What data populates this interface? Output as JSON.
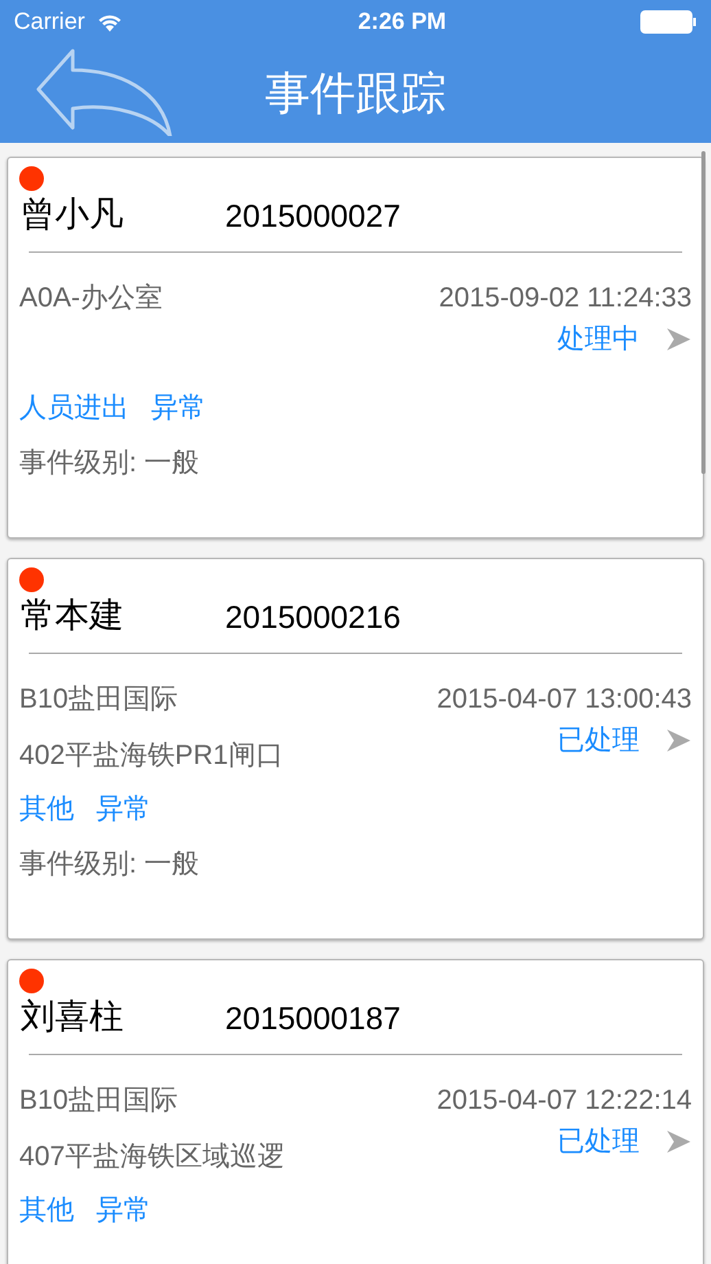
{
  "status_bar": {
    "carrier": "Carrier",
    "time": "2:26 PM"
  },
  "nav": {
    "title": "事件跟踪"
  },
  "events": [
    {
      "color": "#ff3300",
      "name": "曾小凡",
      "number": "2015000027",
      "location": "A0A-办公室",
      "datetime": "2015-09-02 11:24:33",
      "status": "处理中",
      "category": "人员进出",
      "type": "异常",
      "level": "事件级别: 一般"
    },
    {
      "color": "#ff3300",
      "name": "常本建",
      "number": "2015000216",
      "location": "B10盐田国际",
      "sublocation": "402平盐海铁PR1闸口",
      "datetime": "2015-04-07 13:00:43",
      "status": "已处理",
      "category": "其他",
      "type": "异常",
      "level": "事件级别: 一般"
    },
    {
      "color": "#ff3300",
      "name": "刘喜柱",
      "number": "2015000187",
      "location": "B10盐田国际",
      "sublocation": "407平盐海铁区域巡逻",
      "datetime": "2015-04-07 12:22:14",
      "status": "已处理",
      "category": "其他",
      "type": "异常"
    }
  ]
}
